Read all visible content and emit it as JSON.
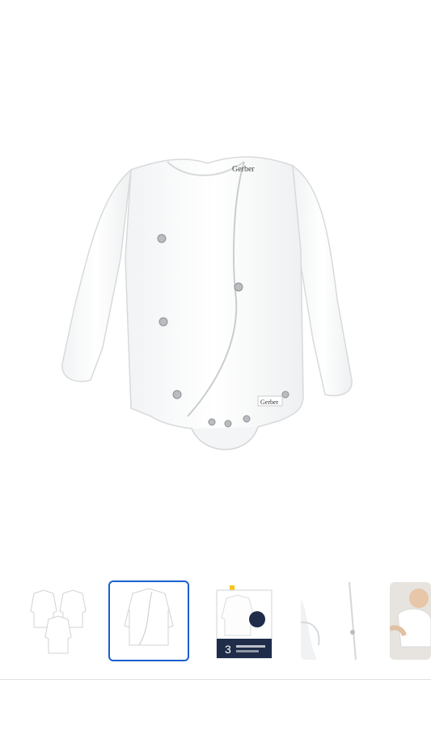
{
  "product": {
    "brand_label": "Gerber",
    "brand_tag": "Gerber"
  },
  "gallery": {
    "selected_index": 1,
    "thumbnails": [
      {
        "name": "three-onesies-thumbnail"
      },
      {
        "name": "side-snap-onesie-thumbnail"
      },
      {
        "name": "package-thumbnail",
        "package_count": "3"
      },
      {
        "name": "mitten-cuff-closeup-thumbnail"
      },
      {
        "name": "baby-wearing-onesie-thumbnail"
      }
    ]
  },
  "colors": {
    "selected_border": "#1a5fd0",
    "divider": "#e2e2e2",
    "package_navy": "#1f2d4a"
  }
}
